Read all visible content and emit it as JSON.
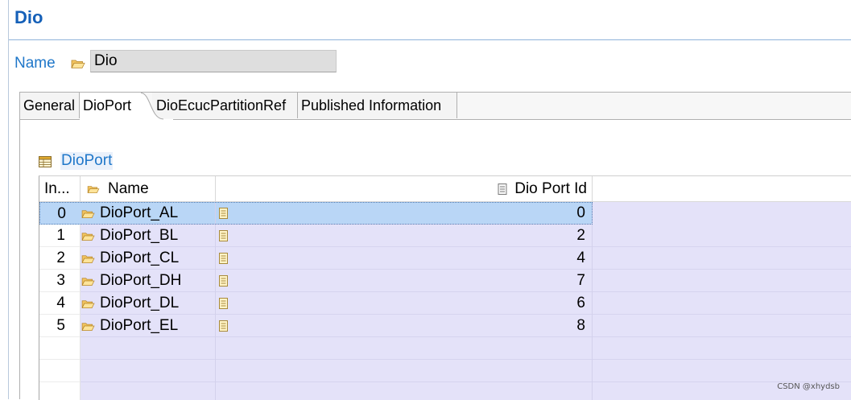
{
  "editor": {
    "title": "Dio"
  },
  "name_field": {
    "label": "Name",
    "value": "Dio"
  },
  "tabs": [
    {
      "label": "General",
      "active": false
    },
    {
      "label": "DioPort",
      "active": true
    },
    {
      "label": "DioEcucPartitionRef",
      "active": false
    },
    {
      "label": "Published Information",
      "active": false
    }
  ],
  "section": {
    "title": "DioPort"
  },
  "table": {
    "columns": {
      "index": "In...",
      "name": "Name",
      "port_id": "Dio Port Id"
    },
    "rows": [
      {
        "index": "0",
        "name": "DioPort_AL",
        "port_id": "0",
        "selected": true
      },
      {
        "index": "1",
        "name": "DioPort_BL",
        "port_id": "2"
      },
      {
        "index": "2",
        "name": "DioPort_CL",
        "port_id": "4"
      },
      {
        "index": "3",
        "name": "DioPort_DH",
        "port_id": "7"
      },
      {
        "index": "4",
        "name": "DioPort_DL",
        "port_id": "6"
      },
      {
        "index": "5",
        "name": "DioPort_EL",
        "port_id": "8"
      }
    ]
  },
  "icons": {
    "folder": "folder-open-icon",
    "parameter": "parameter-icon",
    "table": "table-icon"
  },
  "colors": {
    "accent": "#1f77c9",
    "title": "#1560b8",
    "row_background": "#e4e2f9",
    "selection": "#b9d6f6"
  },
  "watermark": "CSDN @xhydsb"
}
